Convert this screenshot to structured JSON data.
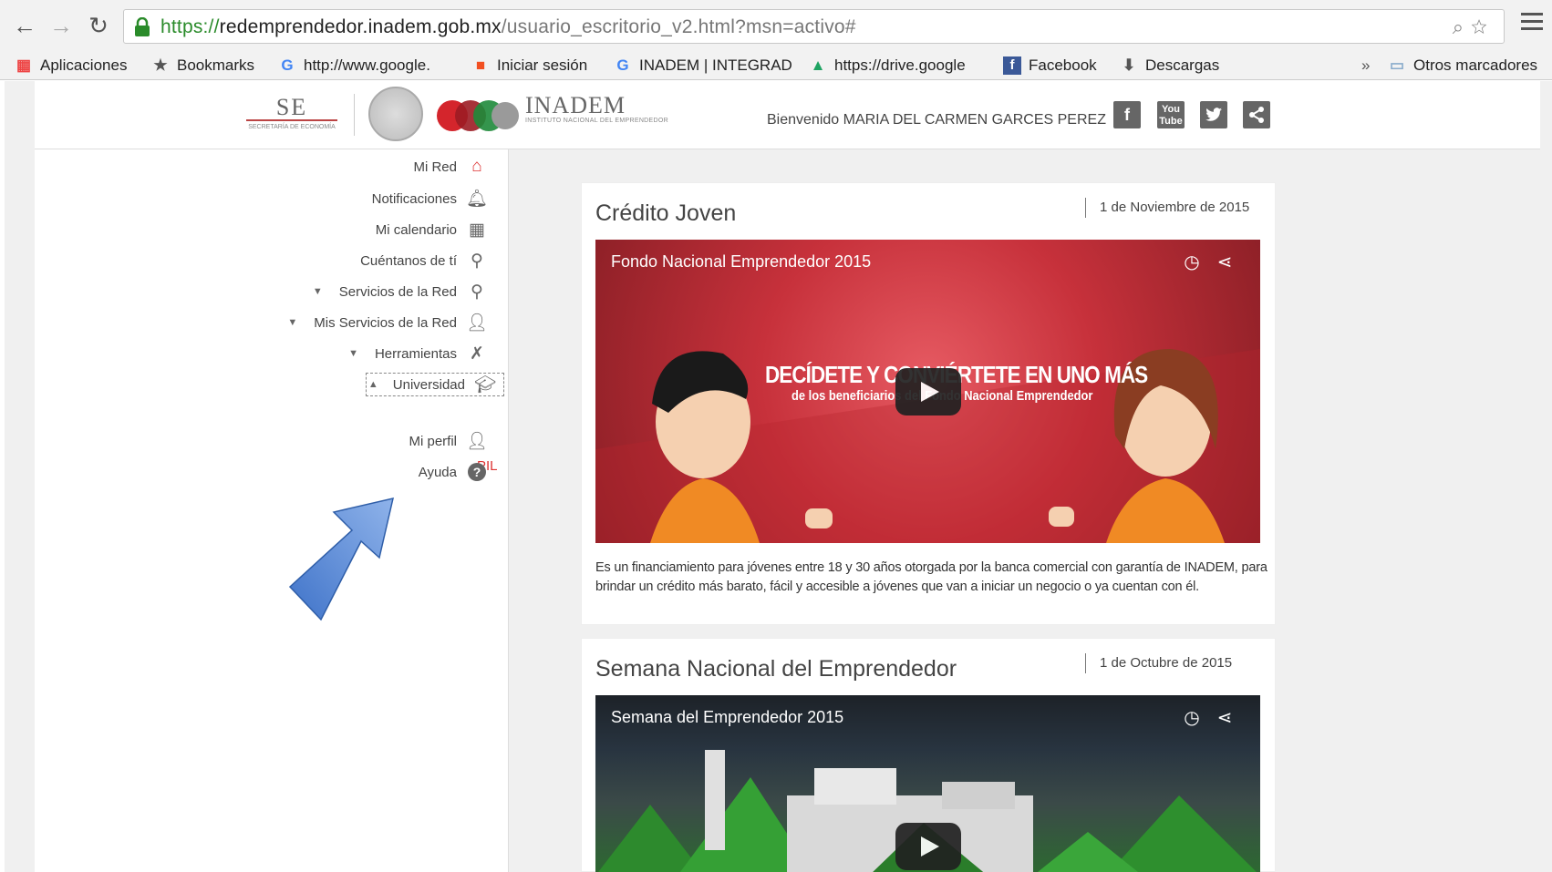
{
  "browser": {
    "url_scheme": "https://",
    "url_host": "redemprendedor.inadem.gob.mx",
    "url_path": "/usuario_escritorio_v2.html?msn=activo#",
    "bookmarks": [
      {
        "label": "Aplicaciones",
        "icon": "apps-grid-icon"
      },
      {
        "label": "Bookmarks",
        "icon": "star-icon"
      },
      {
        "label": "http://www.google.",
        "icon": "google-icon"
      },
      {
        "label": "Iniciar sesión",
        "icon": "windows-icon"
      },
      {
        "label": "INADEM | INTEGRAD",
        "icon": "google-icon"
      },
      {
        "label": "https://drive.google",
        "icon": "drive-icon"
      },
      {
        "label": "Facebook",
        "icon": "facebook-icon"
      },
      {
        "label": "Descargas",
        "icon": "download-icon"
      }
    ],
    "overflow": "»",
    "other_bookmarks": "Otros marcadores"
  },
  "header": {
    "se_logo": "SE",
    "se_logo_sub": "SECRETARÍA DE ECONOMÍA",
    "inadem_logo": "INADEM",
    "inadem_logo_sub": "INSTITUTO NACIONAL DEL EMPRENDEDOR",
    "welcome": "Bienvenido MARIA DEL CARMEN GARCES PEREZ",
    "social": [
      "facebook-icon",
      "youtube-icon",
      "twitter-icon",
      "share-icon"
    ]
  },
  "sidebar": {
    "items": [
      {
        "label": "Mi Red",
        "icon": "home-icon",
        "toggle": ""
      },
      {
        "label": "Notificaciones",
        "icon": "bell-icon",
        "toggle": ""
      },
      {
        "label": "Mi calendario",
        "icon": "calendar-icon",
        "toggle": ""
      },
      {
        "label": "Cuéntanos de tí",
        "icon": "search-icon",
        "toggle": ""
      },
      {
        "label": "Servicios de la Red",
        "icon": "person-icon",
        "toggle": "▼"
      },
      {
        "label": "Mis Servicios de la Red",
        "icon": "user-services-icon",
        "toggle": "▼"
      },
      {
        "label": "Herramientas",
        "icon": "tools-icon",
        "toggle": "▼"
      },
      {
        "label": "Universidad",
        "icon": "graduation-cap-icon",
        "toggle": "▲"
      },
      {
        "label": "Mi perfil",
        "icon": "profile-icon",
        "toggle": ""
      },
      {
        "label": "Ayuda",
        "icon": "help-icon",
        "toggle": ""
      }
    ],
    "sub_item": "PIL"
  },
  "news": [
    {
      "title": "Crédito Joven",
      "date": "1 de Noviembre de 2015",
      "video_title": "Fondo Nacional Emprendedor 2015",
      "video_headline": "DECÍDETE Y CONVIÉRTETE EN UNO MÁS",
      "video_subline": "de los beneficiarios del Fondo Nacional Emprendedor",
      "description": "Es un financiamiento para jóvenes entre 18 y 30 años otorgada por la banca comercial con garantía de INADEM, para brindar un crédito más barato, fácil y accesible a jóvenes que van a iniciar un negocio o ya cuentan con él."
    },
    {
      "title": "Semana Nacional del Emprendedor",
      "date": "1 de Octubre de 2015",
      "video_title": "Semana del Emprendedor 2015"
    }
  ],
  "colors": {
    "link_red": "#dd3333",
    "arrow_blue": "#4a82d8"
  }
}
